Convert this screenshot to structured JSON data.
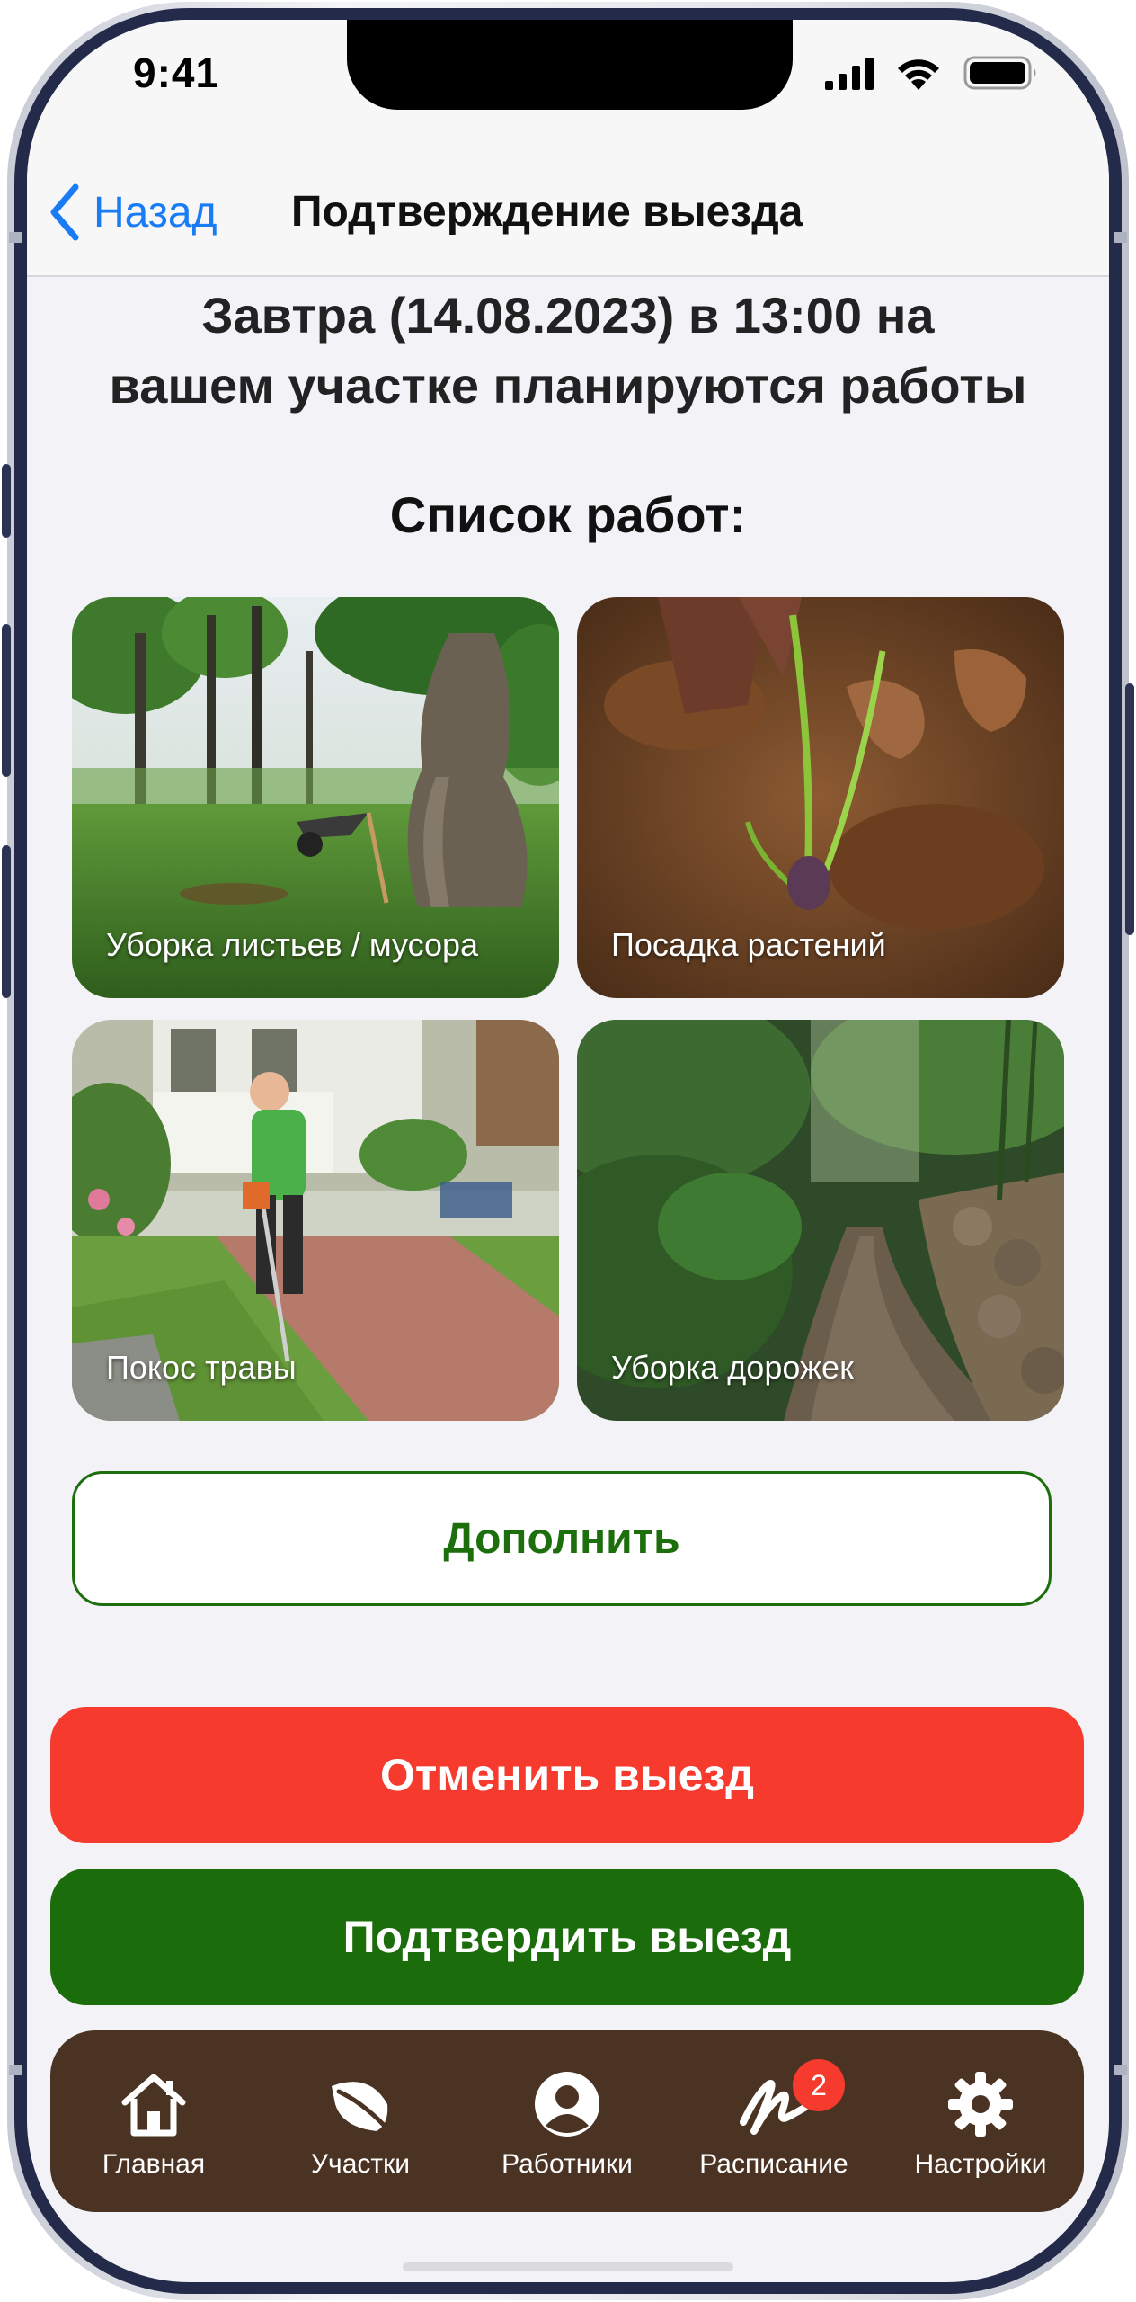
{
  "status_bar": {
    "time": "9:41",
    "icons": [
      "signal-icon",
      "wifi-icon",
      "battery-icon"
    ]
  },
  "nav": {
    "back_label": "Назад",
    "title": "Подтверждение выезда"
  },
  "headline": {
    "line1": "Завтра (14.08.2023) в 13:00 на",
    "line2": "вашем участке планируются работы"
  },
  "works_title": "Список работ:",
  "works": [
    {
      "label": "Уборка листьев / мусора",
      "image": "garden-leaves-photo"
    },
    {
      "label": "Посадка растений",
      "image": "planting-photo"
    },
    {
      "label": "Покос травы",
      "image": "lawn-mowing-photo"
    },
    {
      "label": "Уборка дорожек",
      "image": "garden-path-photo"
    }
  ],
  "buttons": {
    "add": "Дополнить",
    "cancel": "Отменить выезд",
    "confirm": "Подтвердить выезд"
  },
  "tabbar": {
    "items": [
      {
        "label": "Главная",
        "icon": "home-icon"
      },
      {
        "label": "Участки",
        "icon": "leaf-icon"
      },
      {
        "label": "Работники",
        "icon": "user-icon"
      },
      {
        "label": "Расписание",
        "icon": "signature-icon",
        "badge": "2"
      },
      {
        "label": "Настройки",
        "icon": "gear-icon"
      }
    ]
  },
  "colors": {
    "accent_blue": "#1a7cf5",
    "green": "#1b6c0a",
    "red": "#f63a2e",
    "tabbar_brown": "#4a3322",
    "background": "#f2f2f7"
  }
}
